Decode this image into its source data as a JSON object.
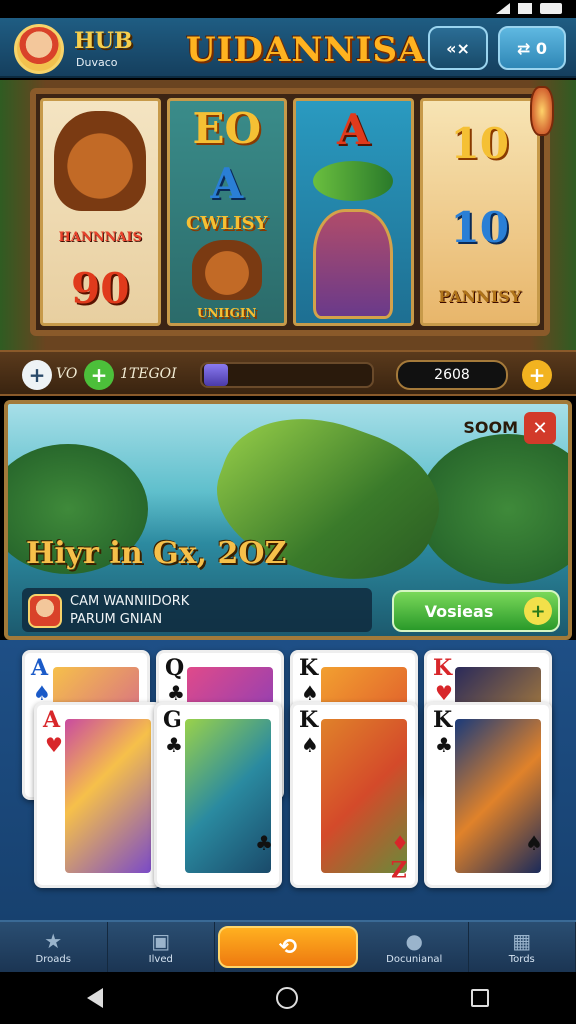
{
  "header": {
    "hub_title": "HUB",
    "hub_subtitle": "Duvaco",
    "game_title": "UIDANNISA!",
    "left_button": "«×",
    "right_button": "⇄ 0"
  },
  "reels": {
    "reel1": {
      "label": "HANNNAIS",
      "value": "90"
    },
    "reel2": {
      "top": "EO",
      "middle": "A",
      "banner": "CWLISY",
      "bottom_label": "UNIIGIN"
    },
    "reel3": {
      "top": "A"
    },
    "reel4": {
      "top": "10",
      "middle": "10",
      "label": "PANNISY"
    }
  },
  "controls": {
    "minus_symbol": "+",
    "v_label": "VO",
    "plus_symbol": "+",
    "bet_label": "1TEGOI",
    "credit": "2608",
    "gold_plus": "+"
  },
  "banner": {
    "amount": "SOOM",
    "close_symbol": "✕",
    "headline": "Hiyr in Gx, 2OZ",
    "footer_line1": "CAM WANNIIDORK",
    "footer_line2": "PARUM GNIAN",
    "cta_label": "Vosieas",
    "cta_plus": "+"
  },
  "cards": [
    {
      "rank": "A",
      "suit": "♠",
      "color": "blue"
    },
    {
      "rank": "Q",
      "suit": "♣",
      "color": "black"
    },
    {
      "rank": "K",
      "suit": "♠",
      "color": "black"
    },
    {
      "rank": "K",
      "suit": "♥",
      "color": "red"
    },
    {
      "rank": "A",
      "suit": "♥",
      "color": "red",
      "br_rank": "",
      "br_suit": ""
    },
    {
      "rank": "G",
      "suit": "♣",
      "color": "black",
      "br_rank": "",
      "br_suit": "♣"
    },
    {
      "rank": "K",
      "suit": "♠",
      "color": "black",
      "br_rank": "Z",
      "br_suit": "♦"
    },
    {
      "rank": "K",
      "suit": "♣",
      "color": "black",
      "br_rank": "",
      "br_suit": "♠"
    }
  ],
  "tabs": [
    {
      "label": "Droads",
      "icon": "star-icon"
    },
    {
      "label": "Ilved",
      "icon": "box-icon"
    },
    {
      "label": "",
      "icon": "refresh-icon"
    },
    {
      "label": "Docunianal",
      "icon": "person-icon"
    },
    {
      "label": "Tords",
      "icon": "grid-icon"
    }
  ],
  "center_symbol": "⟲",
  "colors": {
    "header": "#1f5d83",
    "gold": "#f6c04a",
    "cta_green": "#2a9a2a",
    "center_orange": "#ee7a10"
  }
}
